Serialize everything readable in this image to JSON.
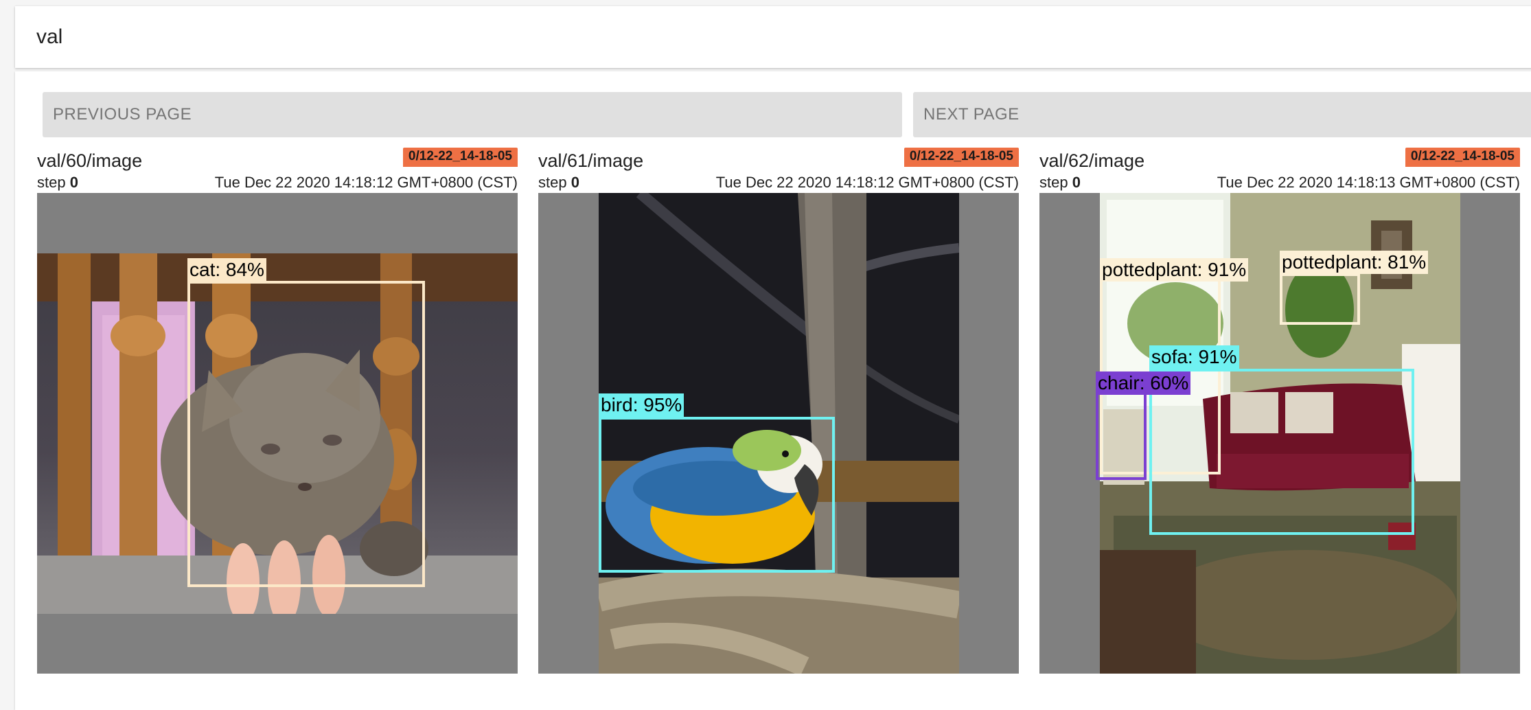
{
  "header": {
    "title": "val"
  },
  "pager": {
    "previous_label": "PREVIOUS PAGE",
    "next_label": "NEXT PAGE"
  },
  "colors": {
    "cat": "#fce8c8",
    "bird": "#6ff1f1",
    "sofa": "#6ff1f1",
    "pottedplant": "#fcf0d6",
    "chair": "#7b3fd1",
    "badge": "#ee7044",
    "placeholder_bg": "#808080"
  },
  "cards": [
    {
      "title": "val/60/image",
      "run": "0/12-22_14-18-05",
      "step_label": "step",
      "step": "0",
      "timestamp": "Tue Dec 22 2020 14:18:12 GMT+0800 (CST)",
      "detections": [
        {
          "label": "cat: 84%"
        }
      ]
    },
    {
      "title": "val/61/image",
      "run": "0/12-22_14-18-05",
      "step_label": "step",
      "step": "0",
      "timestamp": "Tue Dec 22 2020 14:18:12 GMT+0800 (CST)",
      "detections": [
        {
          "label": "bird: 95%"
        }
      ]
    },
    {
      "title": "val/62/image",
      "run": "0/12-22_14-18-05",
      "step_label": "step",
      "step": "0",
      "timestamp": "Tue Dec 22 2020 14:18:13 GMT+0800 (CST)",
      "detections": [
        {
          "label": "pottedplant: 91%"
        },
        {
          "label": "pottedplant: 81%"
        },
        {
          "label": "sofa: 91%"
        },
        {
          "label": "chair: 60%"
        }
      ]
    }
  ]
}
